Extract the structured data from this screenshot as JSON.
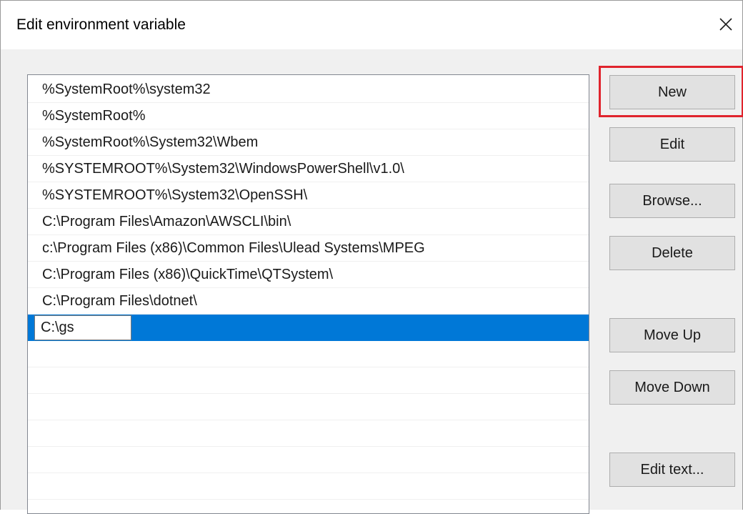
{
  "window": {
    "title": "Edit environment variable"
  },
  "icons": {
    "close": "close-icon"
  },
  "list": {
    "items": [
      "%SystemRoot%\\system32",
      "%SystemRoot%",
      "%SystemRoot%\\System32\\Wbem",
      "%SYSTEMROOT%\\System32\\WindowsPowerShell\\v1.0\\",
      "%SYSTEMROOT%\\System32\\OpenSSH\\",
      "C:\\Program Files\\Amazon\\AWSCLI\\bin\\",
      "c:\\Program Files (x86)\\Common Files\\Ulead Systems\\MPEG",
      "C:\\Program Files (x86)\\QuickTime\\QTSystem\\",
      "C:\\Program Files\\dotnet\\"
    ],
    "editing_value": "C:\\gs"
  },
  "buttons": {
    "new": "New",
    "edit": "Edit",
    "browse": "Browse...",
    "delete": "Delete",
    "move_up": "Move Up",
    "move_down": "Move Down",
    "edit_text": "Edit text..."
  },
  "colors": {
    "selection": "#0078d7",
    "highlight": "#e0242d"
  }
}
